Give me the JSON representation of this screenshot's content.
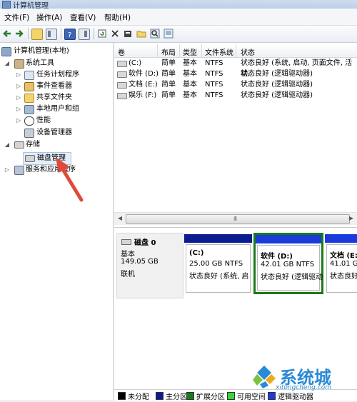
{
  "window": {
    "title": "计算机管理"
  },
  "menu": [
    "文件(F)",
    "操作(A)",
    "查看(V)",
    "帮助(H)"
  ],
  "tree": {
    "root": "计算机管理(本地)",
    "system_tools": "系统工具",
    "task_scheduler": "任务计划程序",
    "event_viewer": "事件查看器",
    "shared_folders": "共享文件夹",
    "local_users": "本地用户和组",
    "performance": "性能",
    "device_manager": "设备管理器",
    "storage": "存储",
    "disk_management": "磁盘管理",
    "services": "服务和应用程序"
  },
  "volume_list": {
    "headers": [
      "卷",
      "布局",
      "类型",
      "文件系统",
      "状态"
    ],
    "rows": [
      {
        "volume": "(C:)",
        "layout": "简单",
        "type": "基本",
        "fs": "NTFS",
        "status": "状态良好 (系统, 启动, 页面文件, 活动,"
      },
      {
        "volume": "软件 (D:)",
        "layout": "简单",
        "type": "基本",
        "fs": "NTFS",
        "status": "状态良好 (逻辑驱动器)"
      },
      {
        "volume": "文档 (E:)",
        "layout": "简单",
        "type": "基本",
        "fs": "NTFS",
        "status": "状态良好 (逻辑驱动器)"
      },
      {
        "volume": "娱乐 (F:)",
        "layout": "简单",
        "type": "基本",
        "fs": "NTFS",
        "status": "状态良好 (逻辑驱动器)"
      }
    ]
  },
  "scrollbar": {
    "grip": "III"
  },
  "disk0": {
    "name": "磁盘 0",
    "kind": "基本",
    "size": "149.05 GB",
    "state": "联机",
    "partitions": [
      {
        "label": "(C:)",
        "size": "25.00 GB NTFS",
        "status": "状态良好 (系统, 启"
      },
      {
        "label": "软件 (D:)",
        "size": "42.01 GB NTFS",
        "status": "状态良好 (逻辑驱动"
      },
      {
        "label": "文档 (E:",
        "size": "41.01 GB",
        "status": "状态良好"
      }
    ]
  },
  "legend": [
    {
      "label": "未分配",
      "color": "#000000"
    },
    {
      "label": "主分区",
      "color": "#0a1c8f"
    },
    {
      "label": "扩展分区",
      "color": "#1a7a1a"
    },
    {
      "label": "可用空间",
      "color": "#36d636"
    },
    {
      "label": "逻辑驱动器",
      "color": "#1a3adb"
    }
  ],
  "colors": {
    "primary_bar": "#0a1c8f",
    "selected_border": "#1a7a1a",
    "arrow": "#e04a3a"
  },
  "watermark": {
    "brand": "系统城",
    "url": "xitongcheng.com"
  }
}
